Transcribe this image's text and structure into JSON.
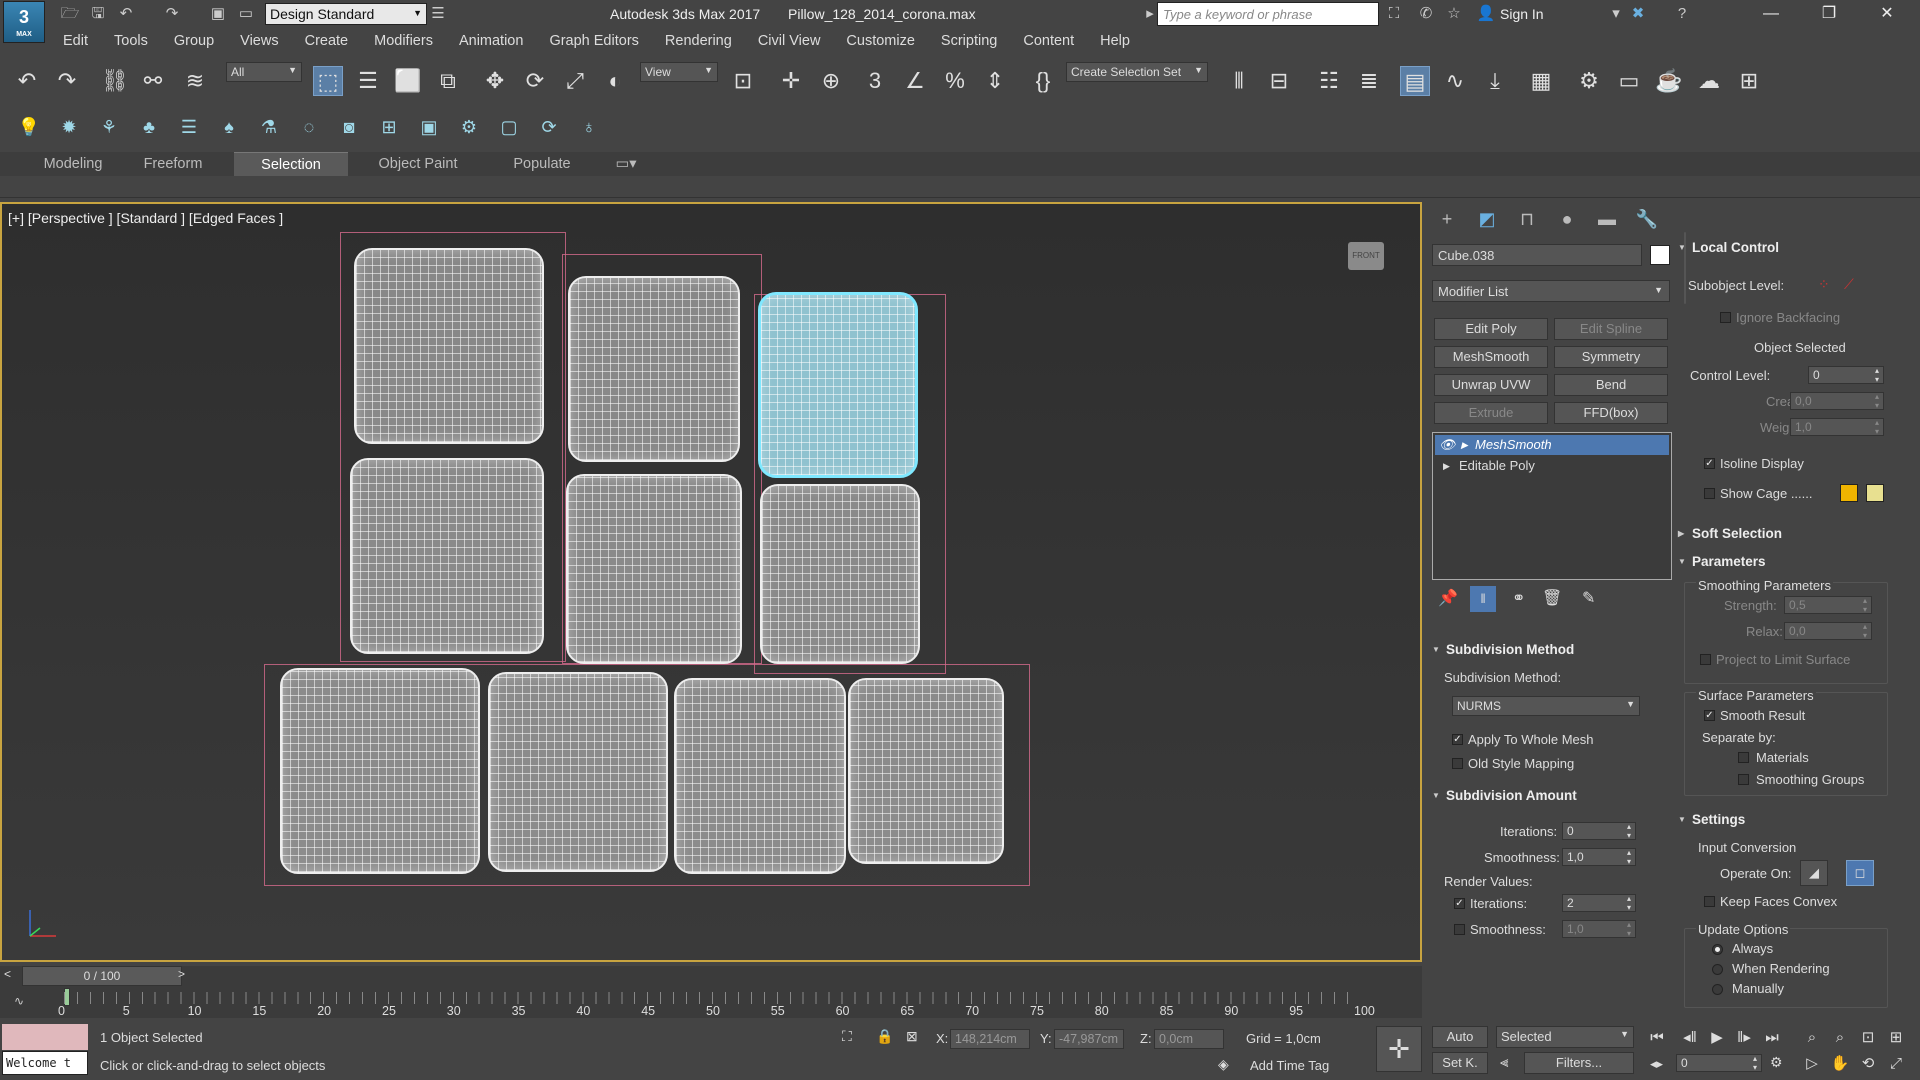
{
  "titlebar": {
    "workspace": "Design Standard",
    "app_title": "Autodesk 3ds Max 2017",
    "file_name": "Pillow_128_2014_corona.max",
    "search_placeholder": "Type a keyword or phrase",
    "sign_in": "Sign In",
    "logo_number": "3",
    "logo_text": "MAX"
  },
  "menu": [
    "Edit",
    "Tools",
    "Group",
    "Views",
    "Create",
    "Modifiers",
    "Animation",
    "Graph Editors",
    "Rendering",
    "Civil View",
    "Customize",
    "Scripting",
    "Content",
    "Help"
  ],
  "toolbar": {
    "selection_filter": "All",
    "reference_coord": "View",
    "named_selection": "Create Selection Set"
  },
  "ribbon_tabs": [
    "Modeling",
    "Freeform",
    "Selection",
    "Object Paint",
    "Populate"
  ],
  "ribbon_active": "Selection",
  "viewport": {
    "label": "[+] [Perspective ] [Standard ] [Edged Faces ]",
    "viewcube": "FRONT"
  },
  "command_panel": {
    "object_name": "Cube.038",
    "modifier_list": "Modifier List",
    "modifier_buttons": [
      {
        "label": "Edit Poly",
        "enabled": true
      },
      {
        "label": "Edit Spline",
        "enabled": false
      },
      {
        "label": "MeshSmooth",
        "enabled": true
      },
      {
        "label": "Symmetry",
        "enabled": true
      },
      {
        "label": "Unwrap UVW",
        "enabled": true
      },
      {
        "label": "Bend",
        "enabled": true
      },
      {
        "label": "Extrude",
        "enabled": false
      },
      {
        "label": "FFD(box)",
        "enabled": true
      }
    ],
    "stack": [
      {
        "label": "MeshSmooth",
        "selected": true
      },
      {
        "label": "Editable Poly",
        "selected": false
      }
    ],
    "subdivision_method": {
      "title": "Subdivision Method",
      "label": "Subdivision Method:",
      "value": "NURMS",
      "apply_whole_mesh": "Apply To Whole Mesh",
      "old_style": "Old Style Mapping"
    },
    "subdivision_amount": {
      "title": "Subdivision Amount",
      "iterations_label": "Iterations:",
      "iterations": "0",
      "smoothness_label": "Smoothness:",
      "smoothness": "1,0",
      "render_values": "Render Values:",
      "render_iterations_label": "Iterations:",
      "render_iterations": "2",
      "render_smoothness_label": "Smoothness:",
      "render_smoothness": "1,0"
    }
  },
  "right_panel": {
    "local_control": "Local Control",
    "subobject_level": "Subobject Level:",
    "ignore_backfacing": "Ignore Backfacing",
    "object_selected": "Object Selected",
    "control_level_label": "Control Level:",
    "control_level": "0",
    "crease_label": "Crease:",
    "crease": "0,0",
    "weight_label": "Weight:",
    "weight": "1,0",
    "isoline_display": "Isoline Display",
    "show_cage": "Show Cage ......",
    "cage_color_1": "#f0b400",
    "cage_color_2": "#e8e090",
    "soft_selection": "Soft Selection",
    "parameters": "Parameters",
    "smoothing_parameters": "Smoothing Parameters",
    "strength_label": "Strength:",
    "strength": "0,5",
    "relax_label": "Relax:",
    "relax": "0,0",
    "project_limit": "Project to Limit Surface",
    "surface_parameters": "Surface Parameters",
    "smooth_result": "Smooth Result",
    "separate_by": "Separate by:",
    "materials": "Materials",
    "smoothing_groups": "Smoothing Groups",
    "settings": "Settings",
    "input_conversion": "Input Conversion",
    "operate_on": "Operate On:",
    "keep_faces_convex": "Keep Faces Convex",
    "update_options": "Update Options",
    "always": "Always",
    "when_rendering": "When Rendering",
    "manually": "Manually"
  },
  "timeline": {
    "frame": "0 / 100",
    "ticks": [
      "0",
      "5",
      "10",
      "15",
      "20",
      "25",
      "30",
      "35",
      "40",
      "45",
      "50",
      "55",
      "60",
      "65",
      "70",
      "75",
      "80",
      "85",
      "90",
      "95",
      "100"
    ]
  },
  "status": {
    "selected": "1 Object Selected",
    "prompt": "Click or click-and-drag to select objects",
    "listener": "Welcome t",
    "x_label": "X:",
    "x": "148,214cm",
    "y_label": "Y:",
    "y": "-47,987cm",
    "z_label": "Z:",
    "z": "0,0cm",
    "grid": "Grid = 1,0cm",
    "add_time_tag": "Add Time Tag",
    "auto": "Auto",
    "set_key": "Set K.",
    "key_mode": "Selected",
    "filters": "Filters...",
    "current_frame": "0"
  },
  "colors": {
    "accent": "#4d78b0",
    "viewport_border": "#c8a440",
    "selected_object": "#7fe8ff"
  }
}
